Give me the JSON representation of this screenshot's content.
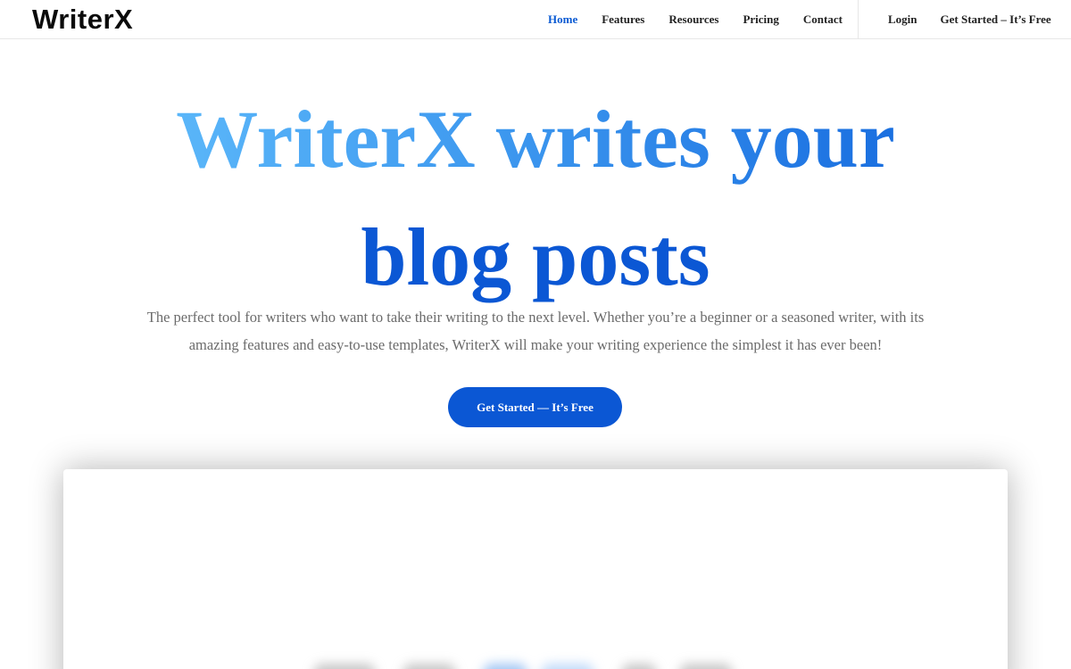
{
  "brand": {
    "logo_text": "WriterX"
  },
  "nav": {
    "items": [
      {
        "label": "Home",
        "active": true
      },
      {
        "label": "Features",
        "active": false
      },
      {
        "label": "Resources",
        "active": false
      },
      {
        "label": "Pricing",
        "active": false
      },
      {
        "label": "Contact",
        "active": false
      }
    ],
    "login_label": "Login",
    "get_started_label": "Get Started – It’s Free"
  },
  "hero": {
    "title_line1": "WriterX writes your",
    "title_line2": "blog posts",
    "subtitle": "The perfect tool for writers who want to take their writing to the next level. Whether you’re a beginner or a seasoned writer, with its amazing features and easy-to-use templates, WriterX will make your writing experience the simplest it has ever been!",
    "cta_label": "Get Started — It’s Free"
  },
  "colors": {
    "accent": "#0b57d4",
    "title_gradient_start": "#5ab6f9",
    "title_gradient_end": "#1a6fe0",
    "nav_active": "#0b5bd3",
    "subtitle_text": "#6b6b6b"
  }
}
